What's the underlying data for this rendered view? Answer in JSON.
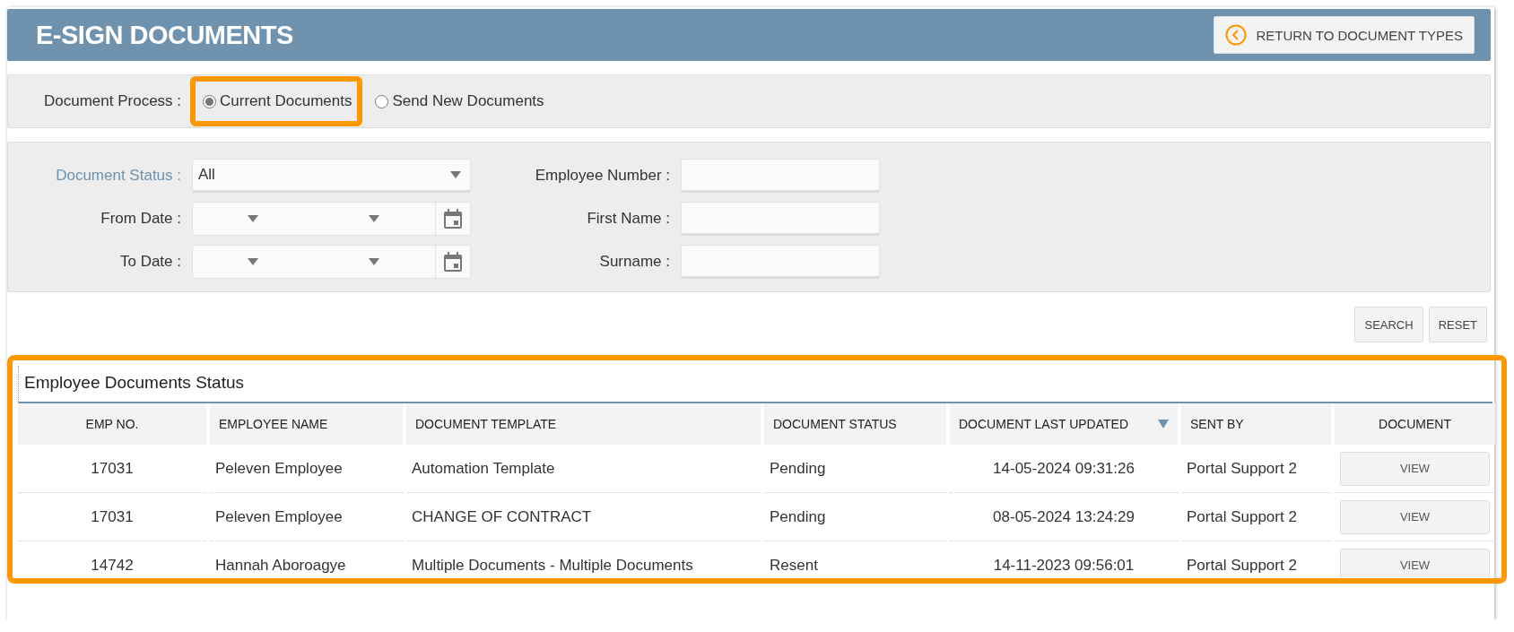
{
  "header": {
    "title": "E-SIGN DOCUMENTS",
    "return_button": "RETURN TO DOCUMENT TYPES"
  },
  "process": {
    "label": "Document Process :",
    "highlighted": true,
    "options": [
      {
        "label": "Current Documents",
        "selected": true
      },
      {
        "label": "Send New Documents",
        "selected": false
      }
    ]
  },
  "filters": {
    "left": [
      {
        "kind": "select",
        "label": "Document Status :",
        "focused": true,
        "value": "All"
      },
      {
        "kind": "daterange",
        "label": "From Date :",
        "focused": false
      },
      {
        "kind": "daterange",
        "label": "To Date :",
        "focused": false
      }
    ],
    "right": [
      {
        "kind": "text",
        "label": "Employee Number :",
        "focused": false
      },
      {
        "kind": "text",
        "label": "First Name :",
        "focused": false
      },
      {
        "kind": "text",
        "label": "Surname :",
        "focused": false
      }
    ]
  },
  "actions": [
    "SEARCH",
    "RESET"
  ],
  "table": {
    "title": "Employee Documents Status",
    "highlighted": true,
    "columns": [
      {
        "label": "EMP NO.",
        "sorted": false
      },
      {
        "label": "EMPLOYEE NAME",
        "sorted": false
      },
      {
        "label": "DOCUMENT TEMPLATE",
        "sorted": false
      },
      {
        "label": "DOCUMENT STATUS",
        "sorted": false
      },
      {
        "label": "DOCUMENT LAST UPDATED",
        "sorted": true
      },
      {
        "label": "SENT BY",
        "sorted": false
      },
      {
        "label": "DOCUMENT",
        "sorted": false
      }
    ],
    "rows": [
      {
        "cells": [
          "17031",
          "Peleven Employee",
          "Automation Template",
          "Pending",
          "14-05-2024 09:31:26",
          "Portal Support 2"
        ],
        "action": "VIEW"
      },
      {
        "cells": [
          "17031",
          "Peleven Employee",
          "CHANGE OF CONTRACT",
          "Pending",
          "08-05-2024 13:24:29",
          "Portal Support 2"
        ],
        "action": "VIEW"
      },
      {
        "cells": [
          "14742",
          "Hannah Aboroagye",
          "Multiple Documents - Multiple Documents",
          "Resent",
          "14-11-2023 09:56:01",
          "Portal Support 2"
        ],
        "action": "VIEW"
      }
    ]
  }
}
